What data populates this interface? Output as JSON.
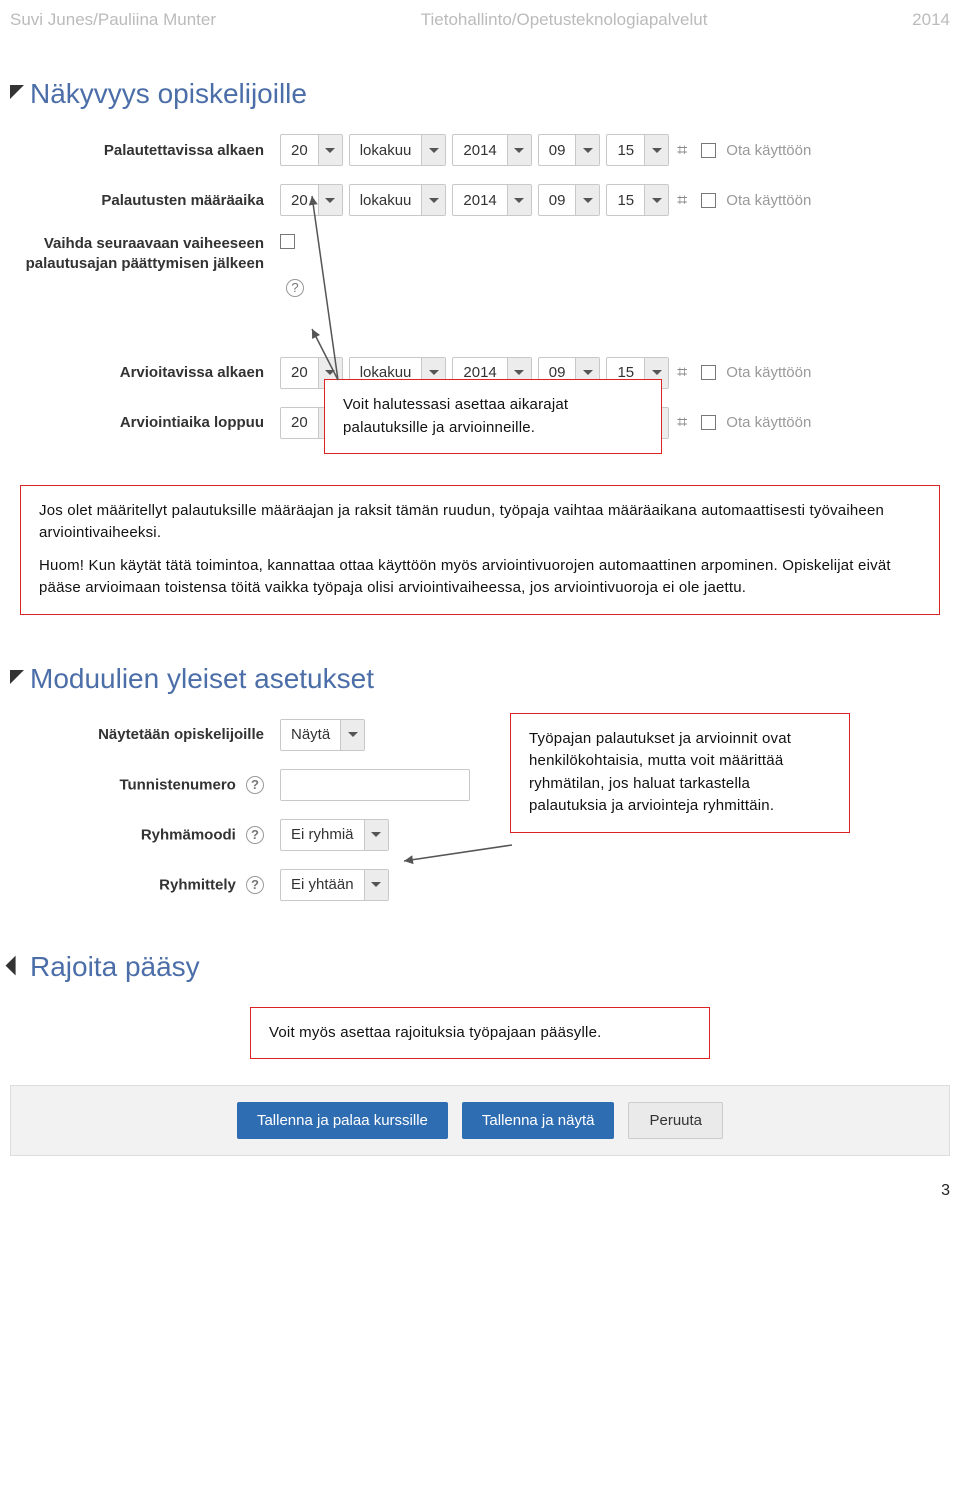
{
  "header": {
    "left": "Suvi Junes/Pauliina Munter",
    "center": "Tietohallinto/Opetusteknologiapalvelut",
    "right": "2014"
  },
  "sections": {
    "visibility": "Näkyvyys opiskelijoille",
    "module": "Moduulien yleiset asetukset",
    "restrict": "Rajoita pääsy"
  },
  "labels": {
    "submitFrom": "Palautettavissa alkaen",
    "submitBy": "Palautusten määräaika",
    "nextPhase": "Vaihda seuraavaan vaiheeseen palautusajan päättymisen jälkeen",
    "assessFrom": "Arvioitavissa alkaen",
    "assessEnd": "Arviointiaika loppuu",
    "showStudents": "Näytetään opiskelijoille",
    "idnumber": "Tunnistenumero",
    "groupmode": "Ryhmämoodi",
    "grouping": "Ryhmittely"
  },
  "date": {
    "day": "20",
    "month": "lokakuu",
    "year": "2014",
    "hour": "09",
    "min": "15"
  },
  "strings": {
    "calendar": "⌗",
    "enable": "Ota käyttöön",
    "show": "Näytä",
    "noGroups": "Ei ryhmiä",
    "noGrouping": "Ei yhtään",
    "help": "?"
  },
  "callouts": {
    "first": "Voit halutessasi asettaa aikarajat palautuksille ja arvioinneille.",
    "second_p1": "Jos olet määritellyt palautuksille määräajan ja raksit tämän ruudun, työpaja vaihtaa määräaikana automaattisesti työvaiheen arviointivaiheeksi.",
    "second_p2": "Huom! Kun käytät tätä toimintoa, kannattaa ottaa käyttöön myös arviointivuorojen automaattinen arpominen. Opiskelijat eivät pääse arvioimaan toistensa töitä vaikka työpaja olisi arviointivaiheessa, jos arviointivuoroja ei ole jaettu.",
    "third": "Työpajan palautukset ja arvioinnit ovat henkilökohtaisia, mutta voit määrittää ryhmätilan, jos haluat tarkastella palautuksia ja arviointeja ryhmittäin.",
    "fourth": "Voit myös asettaa rajoituksia työpajaan pääsylle."
  },
  "buttons": {
    "saveReturn": "Tallenna ja palaa kurssille",
    "saveShow": "Tallenna ja näytä",
    "cancel": "Peruuta"
  },
  "pagenum": "3"
}
